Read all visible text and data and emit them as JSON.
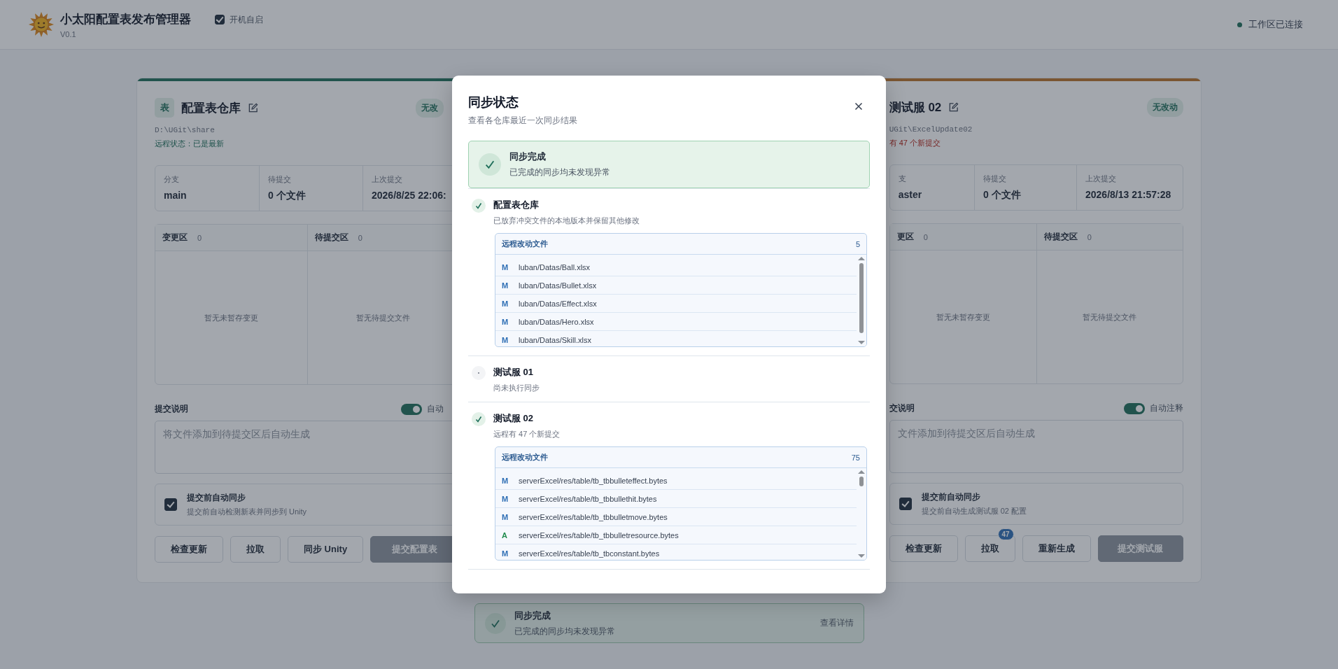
{
  "app": {
    "title": "小太阳配置表发布管理器",
    "version": "V0.1",
    "autostart": {
      "label": "开机自启",
      "checked": true
    },
    "status": {
      "text": "工作区已连接",
      "on": true
    }
  },
  "cards": [
    {
      "icon_label": "表",
      "title": "配置表仓库",
      "badge": "无改",
      "path": "D:\\UGit\\share",
      "remote": {
        "text": "远程状态：已是最新",
        "behind": false
      },
      "stats": [
        {
          "label": "分支",
          "value": "main"
        },
        {
          "label": "待提交",
          "value": "0 个文件"
        },
        {
          "label": "上次提交",
          "value": "2026/8/25 22:06:"
        }
      ],
      "panels": [
        {
          "title": "变更区",
          "count": "0",
          "empty": "暂无未暂存变更"
        },
        {
          "title": "待提交区",
          "count": "0",
          "empty": "暂无待提交文件"
        }
      ],
      "message": {
        "label": "提交说明",
        "toggle_label": "自动",
        "on": true,
        "placeholder": "将文件添加到待提交区后自动生成"
      },
      "auto_sync": {
        "checked": true,
        "title": "提交前自动同步",
        "desc": "提交前自动检测新表并同步到 Unity"
      },
      "buttons": [
        {
          "label": "检查更新",
          "disabled": false
        },
        {
          "label": "拉取",
          "disabled": false
        },
        {
          "label": "同步 Unity",
          "disabled": false
        },
        {
          "label": "提交配置表",
          "disabled": true
        }
      ]
    },
    {
      "title": "测试服 02",
      "badge": "无改动",
      "path": "UGit\\ExcelUpdate02",
      "remote": {
        "text": "有 47 个新提交",
        "behind": true
      },
      "stats": [
        {
          "label": "支",
          "value": "aster"
        },
        {
          "label": "待提交",
          "value": "0 个文件"
        },
        {
          "label": "上次提交",
          "value": "2026/8/13 21:57:28"
        }
      ],
      "panels": [
        {
          "title": "更区",
          "count": "0",
          "empty": "暂无未暂存变更"
        },
        {
          "title": "待提交区",
          "count": "0",
          "empty": "暂无待提交文件"
        }
      ],
      "message": {
        "label": "交说明",
        "toggle_label": "自动注释",
        "on": true,
        "placeholder": "文件添加到待提交区后自动生成"
      },
      "auto_sync": {
        "checked": true,
        "title": "提交前自动同步",
        "desc": "提交前自动生成测试服 02 配置"
      },
      "buttons": [
        {
          "label": "检查更新",
          "disabled": false
        },
        {
          "label": "拉取",
          "disabled": false,
          "badge": "47"
        },
        {
          "label": "重新生成",
          "disabled": false
        },
        {
          "label": "提交测试服",
          "disabled": true
        }
      ]
    }
  ],
  "toast": {
    "title": "同步完成",
    "desc": "已完成的同步均未发现异常",
    "link": "查看详情"
  },
  "dialog": {
    "title": "同步状态",
    "subtitle": "查看各仓库最近一次同步结果",
    "summary": {
      "title": "同步完成",
      "desc": "已完成的同步均未发现异常"
    },
    "items": [
      {
        "synced": true,
        "name": "配置表仓库",
        "desc": "已放弃冲突文件的本地版本并保留其他修改",
        "files": {
          "title": "远程改动文件",
          "count": "5",
          "rows": [
            {
              "kind": "modified",
              "status": "M",
              "path": "luban/Datas/Ball.xlsx"
            },
            {
              "kind": "modified",
              "status": "M",
              "path": "luban/Datas/Bullet.xlsx"
            },
            {
              "kind": "modified",
              "status": "M",
              "path": "luban/Datas/Effect.xlsx"
            },
            {
              "kind": "modified",
              "status": "M",
              "path": "luban/Datas/Hero.xlsx"
            },
            {
              "kind": "modified",
              "status": "M",
              "path": "luban/Datas/Skill.xlsx"
            }
          ]
        }
      },
      {
        "synced": false,
        "name": "测试服 01",
        "desc": "尚未执行同步"
      },
      {
        "synced": true,
        "name": "测试服 02",
        "desc": "远程有 47 个新提交",
        "files": {
          "title": "远程改动文件",
          "count": "75",
          "rows": [
            {
              "kind": "modified",
              "status": "M",
              "path": "serverExcel/res/table/tb_tbbulleteffect.bytes"
            },
            {
              "kind": "modified",
              "status": "M",
              "path": "serverExcel/res/table/tb_tbbullethit.bytes"
            },
            {
              "kind": "modified",
              "status": "M",
              "path": "serverExcel/res/table/tb_tbbulletmove.bytes"
            },
            {
              "kind": "added",
              "status": "A",
              "path": "serverExcel/res/table/tb_tbbulletresource.bytes"
            },
            {
              "kind": "modified",
              "status": "M",
              "path": "serverExcel/res/table/tb_tbconstant.bytes"
            }
          ]
        }
      }
    ]
  }
}
